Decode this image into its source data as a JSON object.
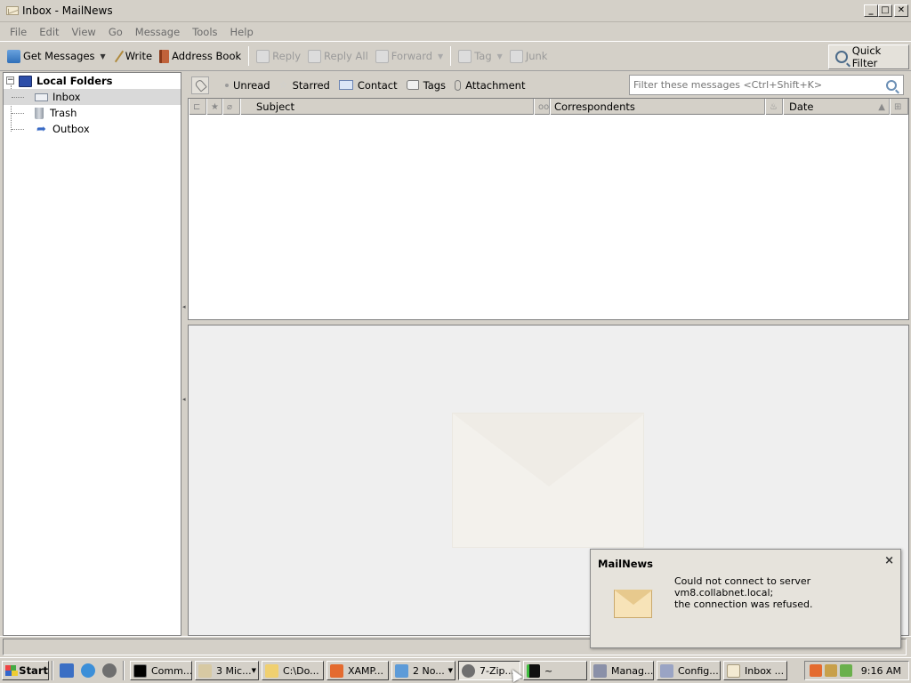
{
  "window": {
    "title": "Inbox - MailNews",
    "buttons": {
      "minimize": "_",
      "maximize": "□",
      "close": "✕"
    }
  },
  "menubar": {
    "items": [
      {
        "label": "File"
      },
      {
        "label": "Edit"
      },
      {
        "label": "View"
      },
      {
        "label": "Go"
      },
      {
        "label": "Message"
      },
      {
        "label": "Tools"
      },
      {
        "label": "Help"
      }
    ]
  },
  "toolbar": {
    "get_messages": "Get Messages",
    "write": "Write",
    "address_book": "Address Book",
    "reply": "Reply",
    "reply_all": "Reply All",
    "forward": "Forward",
    "tag": "Tag",
    "junk": "Junk",
    "quick_filter": "Quick Filter"
  },
  "folders": {
    "root": "Local Folders",
    "items": [
      {
        "label": "Inbox",
        "icon": "inbox-icon",
        "selected": true
      },
      {
        "label": "Trash",
        "icon": "trash-icon",
        "selected": false
      },
      {
        "label": "Outbox",
        "icon": "outbox-icon",
        "selected": false
      }
    ]
  },
  "quick_filter_bar": {
    "unread": "Unread",
    "starred": "Starred",
    "contact": "Contact",
    "tags": "Tags",
    "attachment": "Attachment",
    "search_placeholder": "Filter these messages <Ctrl+Shift+K>"
  },
  "thread_columns": {
    "subject": "Subject",
    "correspondents": "Correspondents",
    "date": "Date"
  },
  "notification": {
    "title": "MailNews",
    "message_line1": "Could not connect to server vm8.collabnet.local;",
    "message_line2": "the connection was refused.",
    "close": "×"
  },
  "taskbar": {
    "start": "Start",
    "tasks": [
      {
        "label": "Comm..."
      },
      {
        "label": "3 Mic..."
      },
      {
        "label": "C:\\Do..."
      },
      {
        "label": "XAMP..."
      },
      {
        "label": "2 No..."
      },
      {
        "label": "7-Zip..."
      },
      {
        "label": "~"
      },
      {
        "label": "Manag..."
      },
      {
        "label": "Config..."
      },
      {
        "label": "Inbox ..."
      }
    ],
    "clock": "9:16 AM"
  },
  "colors": {
    "chrome": "#d4d0c8",
    "selection": "#d9d9d9",
    "disabled_text": "#9a9a9a",
    "message_pane_bg": "#efefef"
  }
}
